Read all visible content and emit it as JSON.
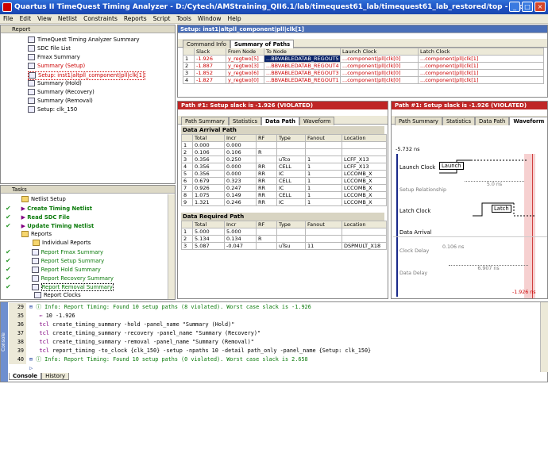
{
  "window": {
    "title": "Quartus II TimeQuest Timing Analyzer - D:/Cytech/AMStraining_QII6.1/lab/timequest61_lab/timequest61_lab_restored/top - top"
  },
  "menu": [
    "File",
    "Edit",
    "View",
    "Netlist",
    "Constraints",
    "Reports",
    "Script",
    "Tools",
    "Window",
    "Help"
  ],
  "report_panel": {
    "title": "Report",
    "items": [
      "TimeQuest Timing Analyzer Summary",
      "SDC File List",
      "Fmax Summary",
      "Summary (Setup)",
      "Setup: inst1|altpll_component|pll|clk[1]",
      "Summary (Hold)",
      "Summary (Recovery)",
      "Summary (Removal)",
      "Setup: clk_150"
    ]
  },
  "tasks_panel": {
    "title": "Tasks",
    "items": [
      {
        "label": "Netlist Setup",
        "check": false
      },
      {
        "label": "Create Timing Netlist",
        "check": true
      },
      {
        "label": "Read SDC File",
        "check": true
      },
      {
        "label": "Update Timing Netlist",
        "check": true
      },
      {
        "label": "Reports",
        "check": false
      },
      {
        "label": "Individual Reports",
        "check": false
      },
      {
        "label": "Report Fmax Summary",
        "check": true
      },
      {
        "label": "Report Setup Summary",
        "check": true
      },
      {
        "label": "Report Hold Summary",
        "check": true
      },
      {
        "label": "Report Recovery Summary",
        "check": true
      },
      {
        "label": "Report Removal Summary",
        "check": true
      },
      {
        "label": "Report Clocks",
        "check": false
      }
    ]
  },
  "setup_panel": {
    "title": "Setup: inst1|altpll_component|pll|clk[1]",
    "tabs": [
      "Command Info",
      "Summary of Paths"
    ],
    "columns": [
      "",
      "Slack",
      "From Node",
      "To Node",
      "Launch Clock",
      "Latch Clock"
    ],
    "rows": [
      [
        "1",
        "-1.926",
        "y_regtwo[5]",
        "...BBVABLEDATAB_REGOUT5",
        "...component|pll|clk[0]",
        "...component|pll|clk[1]"
      ],
      [
        "2",
        "-1.887",
        "y_regtwo[3]",
        "...BBVABLEDATAB_REGOUT4",
        "...component|pll|clk[0]",
        "...component|pll|clk[1]"
      ],
      [
        "3",
        "-1.852",
        "y_regtwo[6]",
        "...BBVABLEDATAB_REGOUT3",
        "...component|pll|clk[0]",
        "...component|pll|clk[1]"
      ],
      [
        "4",
        "-1.827",
        "y_regtwo[0]",
        "...BBVABLEDATAB_REGOUT1",
        "...component|pll|clk[0]",
        "...component|pll|clk[1]"
      ]
    ]
  },
  "path_panel": {
    "title": "Path #1: Setup slack is -1.926 (VIOLATED)",
    "tabs": [
      "Path Summary",
      "Statistics",
      "Data Path",
      "Waveform"
    ],
    "arrival": {
      "title": "Data Arrival Path",
      "columns": [
        "",
        "Total",
        "Incr",
        "RF",
        "Type",
        "Fanout",
        "Location"
      ],
      "rows": [
        [
          "1",
          "0.000",
          "0.000",
          "",
          "",
          "",
          ""
        ],
        [
          "2",
          "0.106",
          "0.106",
          "R",
          "",
          "",
          ""
        ],
        [
          "3",
          "0.356",
          "0.250",
          "",
          "uTco",
          "1",
          "LCFF_X13"
        ],
        [
          "4",
          "0.356",
          "0.000",
          "RR",
          "CELL",
          "1",
          "LCFF_X13"
        ],
        [
          "5",
          "0.356",
          "0.000",
          "RR",
          "IC",
          "1",
          "LCCOMB_X"
        ],
        [
          "6",
          "0.679",
          "0.323",
          "RR",
          "CELL",
          "1",
          "LCCOMB_X"
        ],
        [
          "7",
          "0.926",
          "0.247",
          "RR",
          "IC",
          "1",
          "LCCOMB_X"
        ],
        [
          "8",
          "1.075",
          "0.149",
          "RR",
          "CELL",
          "1",
          "LCCOMB_X"
        ],
        [
          "9",
          "1.321",
          "0.246",
          "RR",
          "IC",
          "1",
          "LCCOMB_X"
        ]
      ]
    },
    "required": {
      "title": "Data Required Path",
      "columns": [
        "",
        "Total",
        "Incr",
        "RF",
        "Type",
        "Fanout",
        "Location"
      ],
      "rows": [
        [
          "1",
          "5.000",
          "5.000",
          "",
          "",
          "",
          ""
        ],
        [
          "2",
          "5.134",
          "0.134",
          "R",
          "",
          "",
          ""
        ],
        [
          "3",
          "5.087",
          "-0.047",
          "",
          "uTsu",
          "11",
          "DSPMULT_X18"
        ]
      ]
    }
  },
  "wave_panel": {
    "title": "Path #1: Setup slack is -1.926 (VIOLATED)",
    "tabs": [
      "Path Summary",
      "Statistics",
      "Data Path",
      "Waveform"
    ],
    "start_time": "-5.732 ns",
    "labels": [
      "Launch Clock",
      "Setup Relationship",
      "Latch Clock",
      "Data Arrival",
      "Clock Delay",
      "Data Delay"
    ],
    "launch_tag": "Launch",
    "latch_tag": "Latch",
    "setup_rel": "5.0 ns",
    "clock_delay": "0.106 ns",
    "data_delay": "6.907 ns",
    "slack_marker": "-1.926 ns"
  },
  "console": {
    "tabs": [
      "Console",
      "History"
    ],
    "side_label": "Console",
    "lines": [
      {
        "num": "29",
        "text": "Info: Report Timing: Found 10 setup paths (8 violated).  Worst case slack is -1.926",
        "kind": "info"
      },
      {
        "num": "35",
        "text": "10 -1.926",
        "kind": "result"
      },
      {
        "num": "36",
        "text": "create_timing_summary -hold -panel_name \"Summary (Hold)\"",
        "kind": "tcl"
      },
      {
        "num": "37",
        "text": "create_timing_summary -recovery -panel_name \"Summary (Recovery)\"",
        "kind": "tcl"
      },
      {
        "num": "38",
        "text": "create_timing_summary -removal -panel_name \"Summary (Removal)\"",
        "kind": "tcl"
      },
      {
        "num": "39",
        "text": "report_timing -to_clock {clk_150} -setup -npaths 10 -detail path_only -panel_name {Setup: clk_150}",
        "kind": "tcl"
      },
      {
        "num": "40",
        "text": "Info: Report Timing: Found 10 setup paths (0 violated).  Worst case slack is 2.658",
        "kind": "info"
      }
    ]
  }
}
